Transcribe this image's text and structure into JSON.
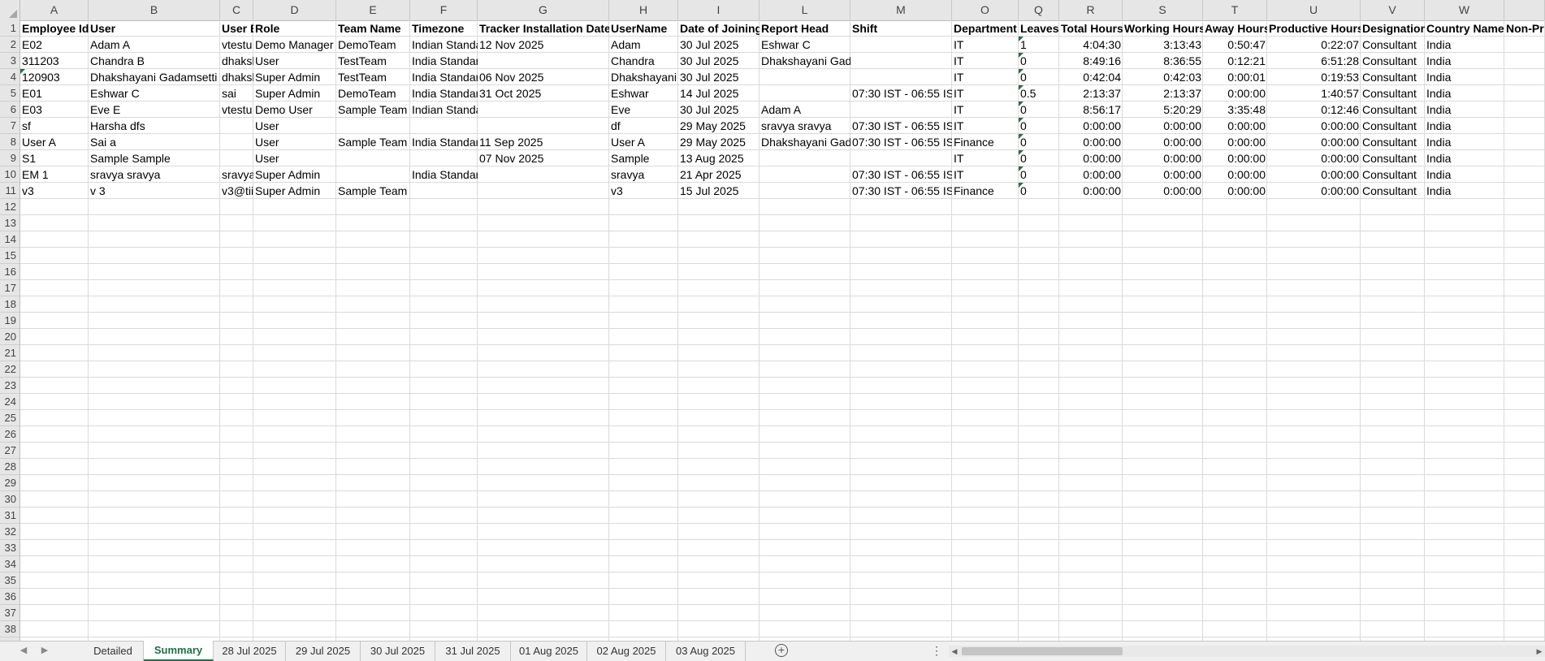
{
  "columns": [
    {
      "letter": "A",
      "header": "Employee Id"
    },
    {
      "letter": "B",
      "header": "User"
    },
    {
      "letter": "C",
      "header": "User E"
    },
    {
      "letter": "D",
      "header": "Role"
    },
    {
      "letter": "E",
      "header": "Team Name"
    },
    {
      "letter": "F",
      "header": "Timezone"
    },
    {
      "letter": "G",
      "header": "Tracker Installation Date"
    },
    {
      "letter": "H",
      "header": "UserName"
    },
    {
      "letter": "I",
      "header": "Date of Joining"
    },
    {
      "letter": "L",
      "header": "Report Head"
    },
    {
      "letter": "M",
      "header": "Shift"
    },
    {
      "letter": "O",
      "header": "Department"
    },
    {
      "letter": "Q",
      "header": "Leaves"
    },
    {
      "letter": "R",
      "header": "Total Hours"
    },
    {
      "letter": "S",
      "header": "Working Hours"
    },
    {
      "letter": "T",
      "header": "Away Hours"
    },
    {
      "letter": "U",
      "header": "Productive Hours"
    },
    {
      "letter": "V",
      "header": "Designation"
    },
    {
      "letter": "W",
      "header": "Country Name"
    },
    {
      "letter": "",
      "header": "Non-Pr"
    }
  ],
  "rows": [
    [
      "E02",
      "Adam A",
      "vtestu",
      "Demo Manager",
      "DemoTeam",
      "Indian Standa",
      "12 Nov 2025",
      "Adam",
      "30 Jul 2025",
      "Eshwar C",
      "",
      "IT",
      "1",
      "4:04:30",
      "3:13:43",
      "0:50:47",
      "0:22:07",
      "Consultant",
      "India",
      ""
    ],
    [
      "311203",
      "Chandra B",
      "dhaksl",
      "User",
      "TestTeam",
      "India Standar",
      "",
      "Chandra",
      "30 Jul 2025",
      "Dhakshayani Gada",
      "",
      "IT",
      "0",
      "8:49:16",
      "8:36:55",
      "0:12:21",
      "6:51:28",
      "Consultant",
      "India",
      ""
    ],
    [
      "120903",
      "Dhakshayani Gadamsetti",
      "dhaksl",
      "Super Admin",
      "TestTeam",
      "India Standar",
      "06 Nov 2025",
      "Dhakshayani",
      "30 Jul 2025",
      "",
      "",
      "IT",
      "0",
      "0:42:04",
      "0:42:03",
      "0:00:01",
      "0:19:53",
      "Consultant",
      "India",
      ""
    ],
    [
      "E01",
      "Eshwar C",
      "sai",
      "Super Admin",
      "DemoTeam",
      "India Standar",
      "31 Oct 2025",
      "Eshwar",
      "14 Jul 2025",
      "",
      "07:30 IST - 06:55 IST",
      "IT",
      "0.5",
      "2:13:37",
      "2:13:37",
      "0:00:00",
      "1:40:57",
      "Consultant",
      "India",
      ""
    ],
    [
      "E03",
      "Eve E",
      "vtestu",
      "Demo User",
      "Sample Team",
      "Indian Standa",
      "",
      "Eve",
      "30 Jul 2025",
      "Adam A",
      "",
      "IT",
      "0",
      "8:56:17",
      "5:20:29",
      "3:35:48",
      "0:12:46",
      "Consultant",
      "India",
      ""
    ],
    [
      "sf",
      "Harsha dfs",
      "",
      "User",
      "",
      "",
      "",
      "df",
      "29 May 2025",
      "sravya sravya",
      "07:30 IST - 06:55 IST",
      "IT",
      "0",
      "0:00:00",
      "0:00:00",
      "0:00:00",
      "0:00:00",
      "Consultant",
      "India",
      ""
    ],
    [
      "User A",
      "Sai a",
      "",
      "User",
      "Sample Team",
      "India Standar",
      "11 Sep 2025",
      "User A",
      "29 May 2025",
      "Dhakshayani Gada",
      "07:30 IST - 06:55 IST",
      "Finance",
      "0",
      "0:00:00",
      "0:00:00",
      "0:00:00",
      "0:00:00",
      "Consultant",
      "India",
      ""
    ],
    [
      "S1",
      "Sample Sample",
      "",
      "User",
      "",
      "",
      "07 Nov 2025",
      "Sample",
      "13 Aug 2025",
      "",
      "",
      "IT",
      "0",
      "0:00:00",
      "0:00:00",
      "0:00:00",
      "0:00:00",
      "Consultant",
      "India",
      ""
    ],
    [
      "EM 1",
      "sravya sravya",
      "sravya",
      "Super Admin",
      "",
      "India Standar",
      "",
      "sravya",
      "21 Apr 2025",
      "",
      "07:30 IST - 06:55 IST",
      "IT",
      "0",
      "0:00:00",
      "0:00:00",
      "0:00:00",
      "0:00:00",
      "Consultant",
      "India",
      ""
    ],
    [
      "v3",
      "v 3",
      "v3@tii",
      "Super Admin",
      "Sample Team",
      "",
      "",
      "v3",
      "15 Jul 2025",
      "",
      "07:30 IST - 06:55 IST",
      "Finance",
      "0",
      "0:00:00",
      "0:00:00",
      "0:00:00",
      "0:00:00",
      "Consultant",
      "India",
      ""
    ]
  ],
  "row_count": 38,
  "sheet_tabs": [
    "Detailed",
    "Summary",
    "28 Jul 2025",
    "29 Jul 2025",
    "30 Jul 2025",
    "31 Jul 2025",
    "01 Aug 2025",
    "02 Aug 2025",
    "03 Aug 2025"
  ],
  "active_tab": "Summary",
  "icons": {
    "prev": "triangle-left-icon",
    "next": "triangle-right-icon",
    "add": "plus-circle-icon",
    "more": "vertical-ellipsis-icon"
  },
  "colors": {
    "accent": "#1e7145",
    "header_bg": "#e6e6e6",
    "grid_line": "#dadada"
  }
}
